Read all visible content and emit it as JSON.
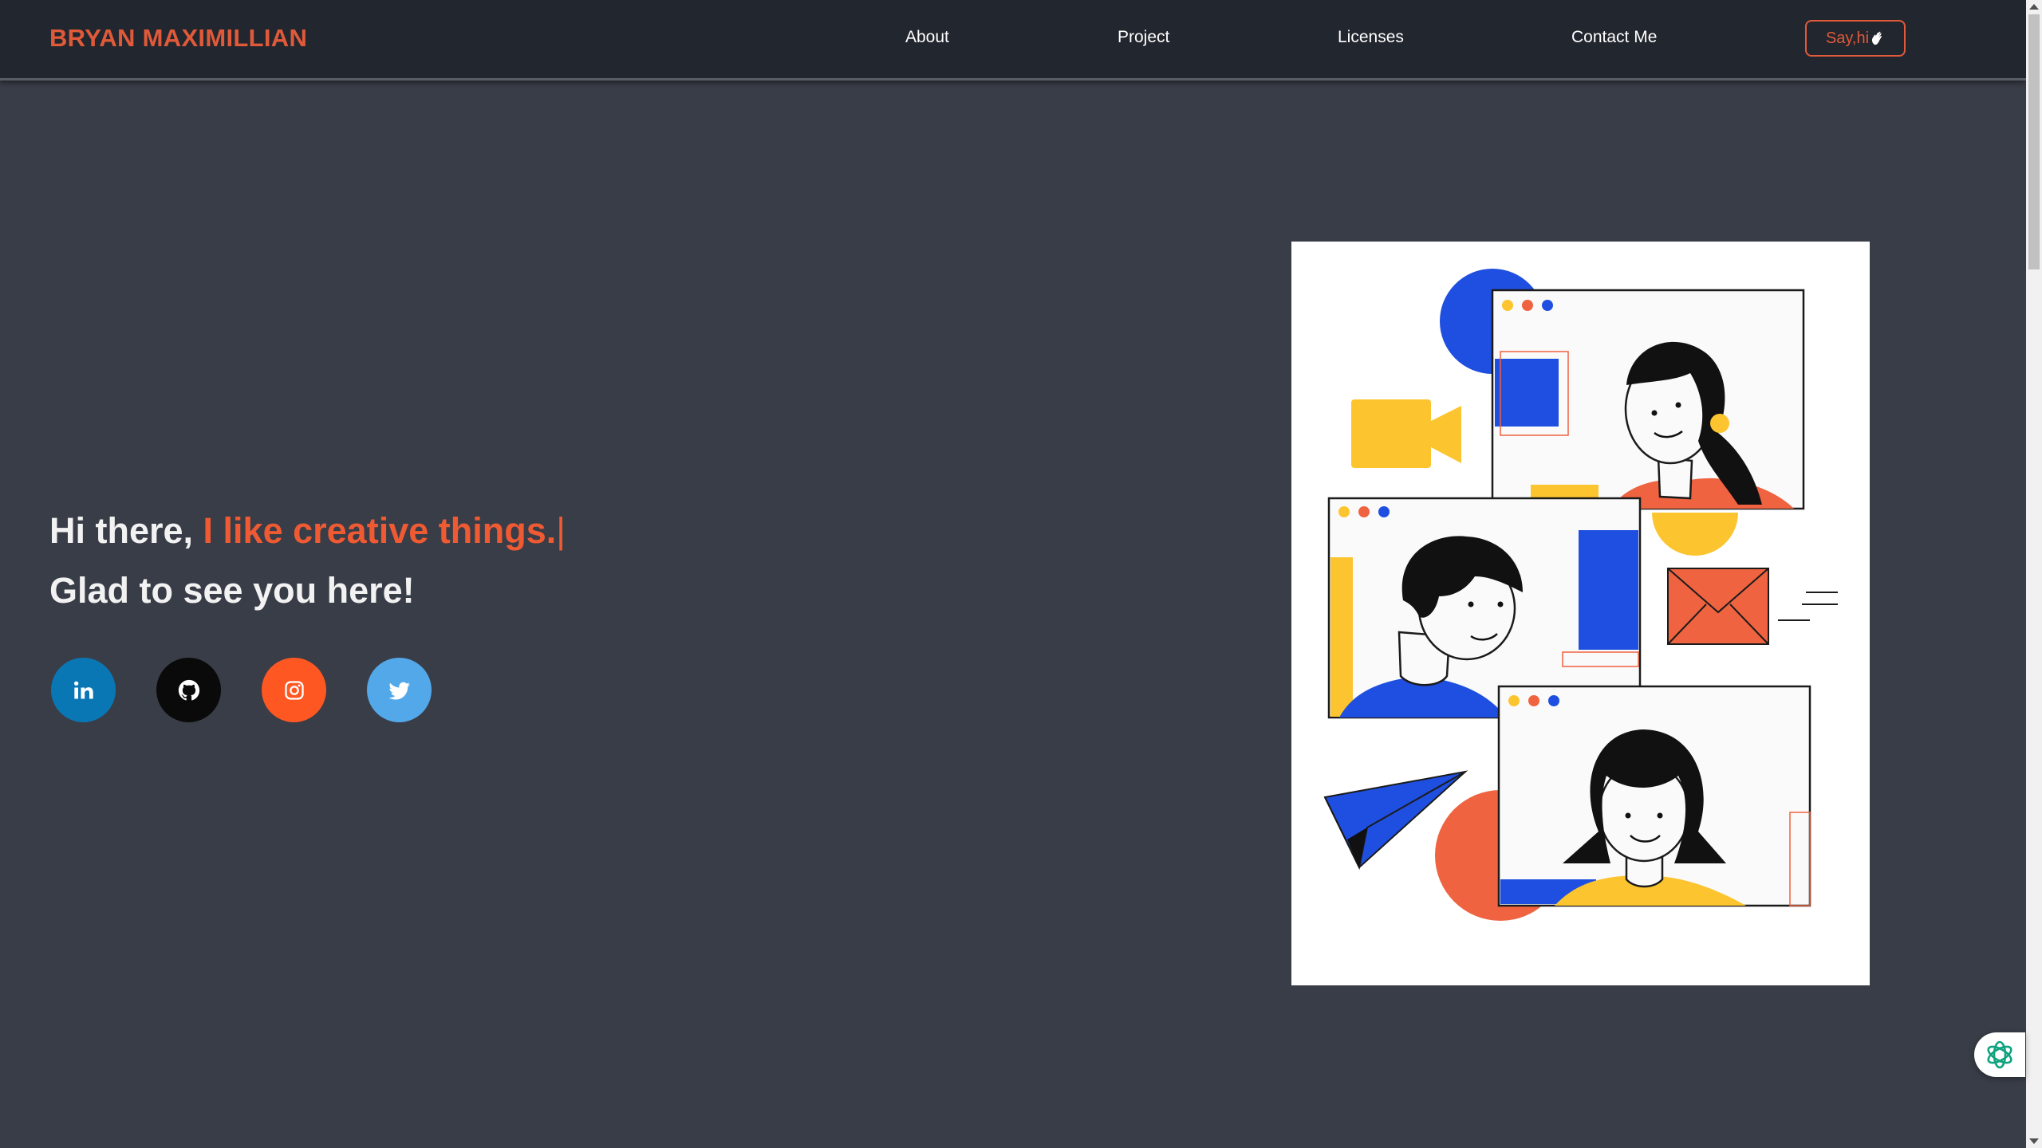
{
  "brand": {
    "name": "BRYAN MAXIMILLIAN"
  },
  "nav": {
    "links": [
      {
        "label": "About"
      },
      {
        "label": "Project"
      },
      {
        "label": "Licenses"
      },
      {
        "label": "Contact Me"
      }
    ],
    "cta": {
      "label": "Say,hi",
      "icon": "waving-hand-icon"
    }
  },
  "hero": {
    "line1_prefix": "Hi there, ",
    "line1_highlight": "I like creative things.",
    "typing_cursor": "|",
    "line2": "Glad to see you here!"
  },
  "socials": [
    {
      "icon": "linkedin-icon",
      "color": "#0a77b5"
    },
    {
      "icon": "github-icon",
      "color": "#0a0a0a"
    },
    {
      "icon": "instagram-icon",
      "color": "#fe5722"
    },
    {
      "icon": "twitter-icon",
      "color": "#53a8ea"
    }
  ],
  "colors": {
    "accent": "#e05a3a",
    "background": "#393d47",
    "navbar": "#22262e"
  },
  "illustration": {
    "subject": "video-call-illustration"
  },
  "widget": {
    "icon": "openai-assistant-icon"
  }
}
